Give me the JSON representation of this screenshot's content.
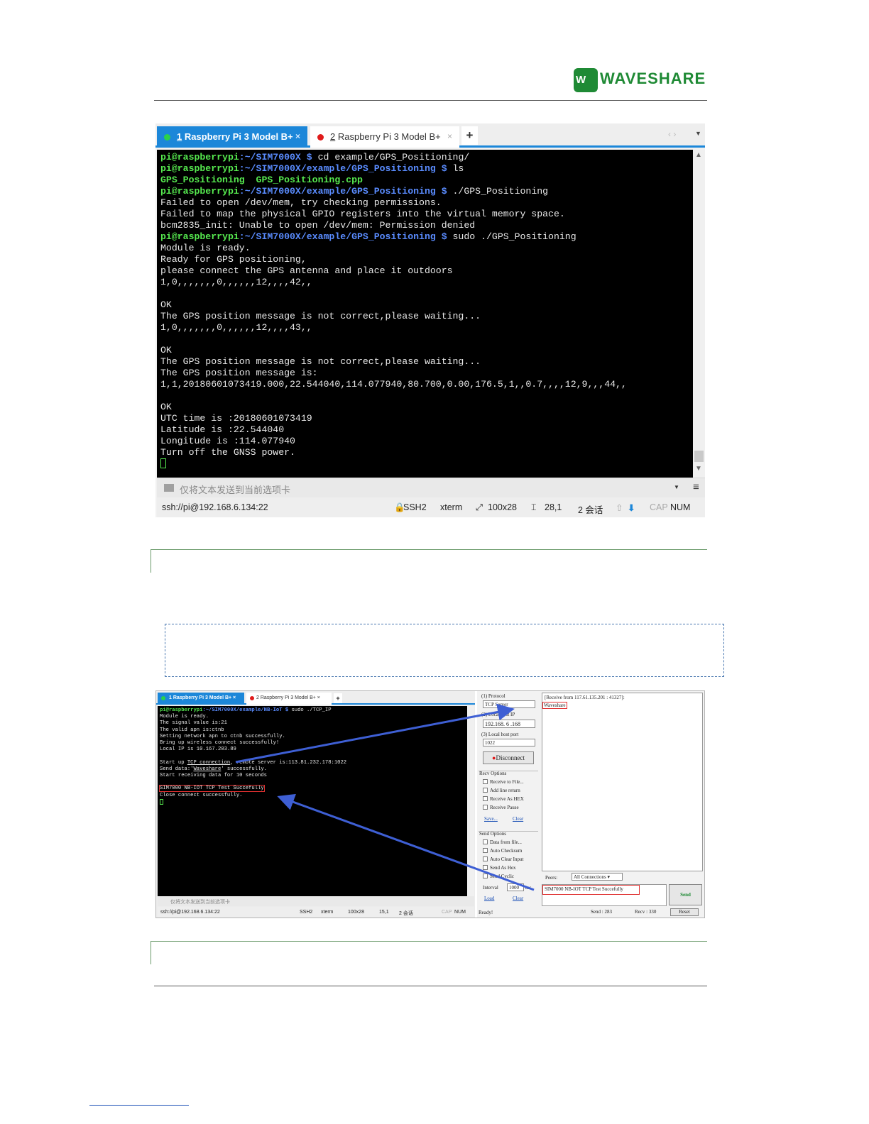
{
  "brand": {
    "logo_mark": "W",
    "logo_text": "WAVESHARE"
  },
  "terminal1": {
    "tabs": [
      {
        "num": "1",
        "label": " Raspberry Pi 3 Model B+",
        "close": "×",
        "dot_color": "#2bd14a"
      },
      {
        "num": "2",
        "label": " Raspberry Pi 3 Model B+",
        "close": "×",
        "dot_color": "#e01b1b"
      }
    ],
    "add_tab": "+",
    "nav_arrows": "‹  ›",
    "tab_menu": "▼",
    "input_placeholder": "仅将文本发送到当前选项卡",
    "input_dropdown": "▼",
    "input_menu": "≡",
    "status": {
      "url": "ssh://pi@192.168.6.134:22",
      "protocol": "SSH2",
      "term": "xterm",
      "size": "100x28",
      "cursor": "28,1",
      "sessions": "2 会话",
      "up": "⇧",
      "down": "⬇",
      "cap": "CAP",
      "num": "NUM"
    },
    "lines": {
      "l1_prompt": "pi@raspberrypi",
      "l1_dir": ":~/SIM7000X $",
      "l1_cmd": " cd example/GPS_Positioning/",
      "l2_prompt": "pi@raspberrypi",
      "l2_dir": ":~/SIM7000X/example/GPS_Positioning $",
      "l2_cmd": " ls",
      "l3": "GPS_Positioning  GPS_Positioning.cpp",
      "l4_prompt": "pi@raspberrypi",
      "l4_dir": ":~/SIM7000X/example/GPS_Positioning $",
      "l4_cmd": " ./GPS_Positioning",
      "l5": "Failed to open /dev/mem, try checking permissions.",
      "l6": "Failed to map the physical GPIO registers into the virtual memory space.",
      "l7": "bcm2835_init: Unable to open /dev/mem: Permission denied",
      "l8_prompt": "pi@raspberrypi",
      "l8_dir": ":~/SIM7000X/example/GPS_Positioning $",
      "l8_cmd": " sudo ./GPS_Positioning",
      "l9": "Module is ready.",
      "l10": "Ready for GPS positioning,",
      "l11": "please connect the GPS antenna and place it outdoors",
      "l12": "1,0,,,,,,,0,,,,,,12,,,,42,,",
      "l13": "",
      "l14": "OK",
      "l15": "The GPS position message is not correct,please waiting...",
      "l16": "1,0,,,,,,,0,,,,,,12,,,,43,,",
      "l17": "",
      "l18": "OK",
      "l19": "The GPS position message is not correct,please waiting...",
      "l20": "The GPS position message is:",
      "l21": "1,1,20180601073419.000,22.544040,114.077940,80.700,0.00,176.5,1,,0.7,,,,12,9,,,44,,",
      "l22": "",
      "l23": "OK",
      "l24": "UTC time is :20180601073419",
      "l25": "Latitude is :22.544040",
      "l26": "Longitude is :114.077940",
      "l27": "Turn off the GNSS power."
    }
  },
  "terminal2": {
    "tab1": "1 Raspberry Pi 3 Model B+  ×",
    "tab2": "2 Raspberry Pi 3 Model B+  ×",
    "add_tab": "+",
    "prompt": "pi@raspberrypi",
    "dir": ":~/SIM7000X/example/NB-IoT $",
    "cmd": " sudo ./TCP_IP",
    "o1": "Module is ready.",
    "o2": "The signal value is:21",
    "o3": "The valid apn is:ctnb",
    "o4": "Setting network apn to ctnb successfully.",
    "o5": "Bring up wireless connect successfully!",
    "o6": "Local IP is 10.167.203.89",
    "o7": "",
    "o8a": "Start up ",
    "o8b": "TCP connection",
    "o8c": ", remote server is:113.81.232.178:1022",
    "o9a": "Send data:'",
    "o9b": "Waveshare",
    "o9c": "' successfully.",
    "o10": "Start receiving data for 10 seconds",
    "o11": "",
    "o12": "SIM7000 NB-IOT TCP Test Succefully",
    "o13": "Close connect successfully.",
    "input_placeholder": "仅将文本发送到当前选项卡",
    "status": {
      "url": "ssh://pi@192.168.6.134:22",
      "protocol": "SSH2",
      "term": "xterm",
      "size": "100x28",
      "cursor": "15,1",
      "sessions": "2 会话",
      "cap": "CAP",
      "num": "NUM"
    }
  },
  "netassist": {
    "protocol_label": "(1) Protocol",
    "protocol_value": "TCP Server",
    "host_ip_label": "(2) Local host IP",
    "host_ip_value": "192.168. 6 .168",
    "port_label": "(3) Local host port",
    "port_value": "1022",
    "disconnect": "Disconnect",
    "recv_options": "Recv Options",
    "recv_to_file": "Receive to File...",
    "add_line_return": "Add line return",
    "receive_as_hex": "Receive As HEX",
    "receive_pause": "Receive Pause",
    "save": "Save...",
    "clear": "Clear",
    "send_options": "Send Options",
    "data_from_file": "Data from file...",
    "auto_checksum": "Auto Checksum",
    "auto_clear_input": "Auto Clear Input",
    "send_as_hex": "Send As Hex",
    "send_cyclic": "Send Cyclic",
    "interval_label": "Interval",
    "interval_value": "1000",
    "interval_unit": "ms",
    "load": "Load",
    "clear2": "Clear",
    "recv_header": "[Receive from 117.61.135.201 : 41327]:",
    "recv_data": "Waveshare",
    "peers_label": "Peers:",
    "peers_value": "All Connections",
    "send_text": "SIM7000 NB-IOT TCP Test Succefully",
    "send_button": "Send",
    "ready": "Ready!",
    "send_count": "Send : 283",
    "recv_count": "Recv : 330",
    "reset": "Reset"
  },
  "colors": {
    "prompt_green": "#56e94f",
    "path_blue": "#5a8cff",
    "tab_blue": "#1c87d9",
    "annot_red": "#e03030",
    "arrow_blue": "#3e5fd4",
    "brand_green": "#1f8a35"
  }
}
